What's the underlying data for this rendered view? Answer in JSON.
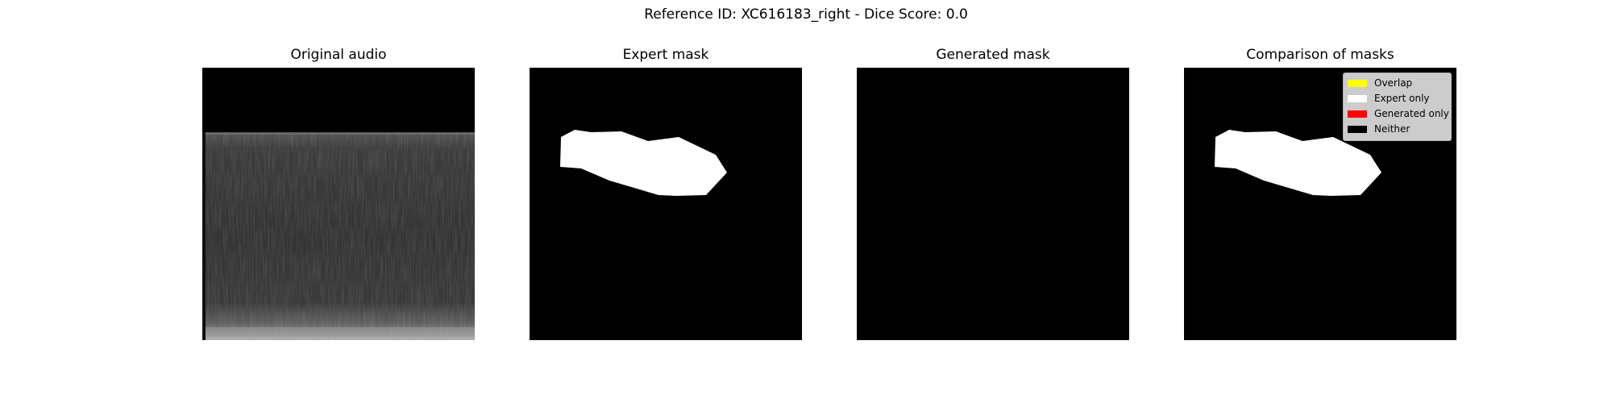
{
  "figure": {
    "title": "Reference ID: XC616183_right - Dice Score: 0.0"
  },
  "panels": [
    {
      "title": "Original audio"
    },
    {
      "title": "Expert mask"
    },
    {
      "title": "Generated mask"
    },
    {
      "title": "Comparison of masks"
    }
  ],
  "legend": {
    "placement": "top-right",
    "items": [
      {
        "label": "Overlap",
        "color": "#ffff00"
      },
      {
        "label": "Expert only",
        "color": "#ffffff"
      },
      {
        "label": "Generated only",
        "color": "#ff0000"
      },
      {
        "label": "Neither",
        "color": "#000000"
      }
    ]
  },
  "colors": {
    "background": "#ffffff",
    "mask_background": "#000000",
    "expert_mask": "#ffffff"
  }
}
